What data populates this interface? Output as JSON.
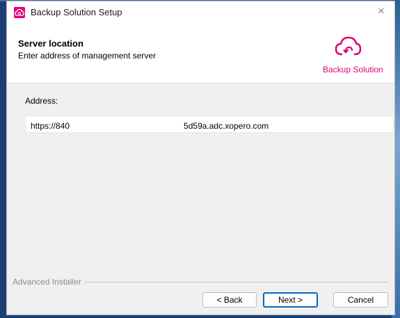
{
  "window": {
    "title": "Backup Solution Setup",
    "close_glyph": "×"
  },
  "header": {
    "title": "Server location",
    "subtitle": "Enter address of management server",
    "logo_text": "Backup Solution",
    "logo_icon": "cloud-upload-icon"
  },
  "form": {
    "address_label": "Address:",
    "address_value_start": "https://840",
    "address_value_end": "5d59a.adc.xopero.com"
  },
  "footer": {
    "installer_label": "Advanced Installer",
    "back_label": "< Back",
    "next_label": "Next >",
    "cancel_label": "Cancel"
  },
  "colors": {
    "brand": "#e2007a",
    "focus": "#0067c0"
  }
}
